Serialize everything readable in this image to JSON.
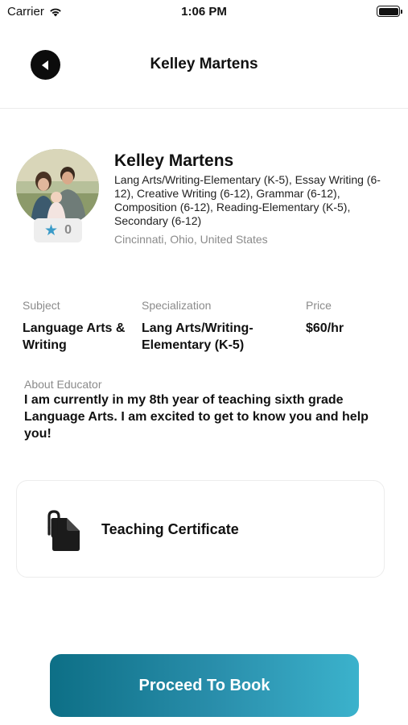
{
  "status_bar": {
    "carrier": "Carrier",
    "time": "1:06 PM",
    "icons": [
      "wifi-icon",
      "battery-icon"
    ]
  },
  "nav": {
    "title": "Kelley Martens",
    "back_icon": "back-arrow-icon"
  },
  "profile": {
    "name": "Kelley Martens",
    "subjects": "Lang Arts/Writing-Elementary (K-5), Essay Writing (6-12), Creative Writing (6-12), Grammar (6-12), Composition (6-12), Reading-Elementary (K-5), Secondary (6-12)",
    "location": "Cincinnati, Ohio, United States",
    "rating": "0",
    "rating_icon": "star-icon"
  },
  "details": {
    "subject_label": "Subject",
    "subject_value": "Language Arts & Writing",
    "specialization_label": "Specialization",
    "specialization_value": "Lang Arts/Writing-Elementary (K-5)",
    "price_label": "Price",
    "price_value": "$60/hr"
  },
  "about": {
    "label": "About Educator",
    "text": "I am currently in my 8th year of teaching sixth grade Language Arts. I am excited to get to know you and help you!"
  },
  "certificate": {
    "label": "Teaching Certificate",
    "icon": "document-attachment-icon"
  },
  "actions": {
    "proceed_label": "Proceed To Book"
  },
  "colors": {
    "accent_start": "#0d6f86",
    "accent_end": "#3bb2cc",
    "star": "#3a9bc8",
    "muted_text": "#8b8b8b"
  }
}
